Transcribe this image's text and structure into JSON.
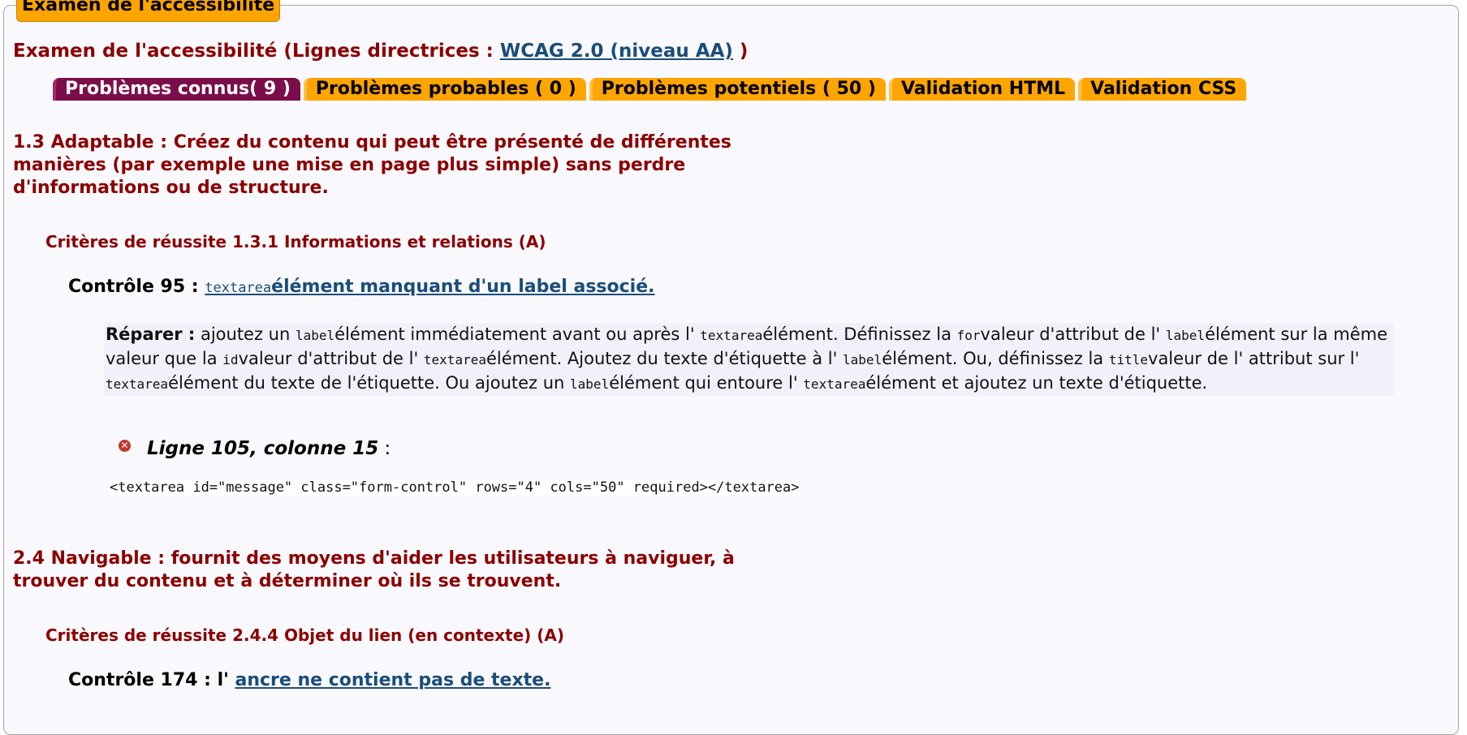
{
  "legend": "Examen de l'accessibilité",
  "main_title": {
    "prefix": "Examen de l'accessibilité (Lignes directrices : ",
    "link": "WCAG 2.0 (niveau AA)",
    "suffix": " )"
  },
  "tabs": [
    {
      "label": "Problèmes connus( 9 )",
      "active": true
    },
    {
      "label": "Problèmes probables ( 0 )",
      "active": false
    },
    {
      "label": "Problèmes potentiels ( 50 )",
      "active": false
    },
    {
      "label": "Validation HTML",
      "active": false
    },
    {
      "label": "Validation CSS",
      "active": false
    }
  ],
  "sections": [
    {
      "heading": "1.3 Adaptable : Créez du contenu qui peut être présenté de différentes manières (par exemple une mise en page plus simple) sans perdre d'informations ou de structure.",
      "criteria": "Critères de réussite 1.3.1 Informations et relations (A)",
      "control": {
        "prefix": "Contrôle 95 : ",
        "code": "textarea",
        "link": "élément manquant d'un label associé."
      },
      "repair": {
        "label": "Réparer :",
        "t1": " ajoutez un ",
        "c1": "label",
        "t2": "élément immédiatement avant ou après l' ",
        "c2": "textarea",
        "t3": "élément. Définissez la ",
        "c3": "for",
        "t4": "valeur d'attribut de l' ",
        "c4": "label",
        "t5": "élément sur la même valeur que la ",
        "c5": "id",
        "t6": "valeur d'attribut de l' ",
        "c6": "textarea",
        "t7": "élément. Ajoutez du texte d'étiquette à l' ",
        "c7": "label",
        "t8": "élément. Ou, définissez la ",
        "c8": "title",
        "t9": "valeur de l' attribut sur l' ",
        "c9": "textarea",
        "t10": "élément du texte de l'étiquette. Ou ajoutez un ",
        "c10": "label",
        "t11": "élément qui entoure l' ",
        "c11": "textarea",
        "t12": "élément et ajoutez un texte d'étiquette."
      },
      "line_ref": "Ligne 105, colonne 15",
      "line_ref_suffix": " :",
      "code_snippet": "<textarea id=\"message\" class=\"form-control\" rows=\"4\" cols=\"50\" required></textarea>"
    },
    {
      "heading": "2.4 Navigable : fournit des moyens d'aider les utilisateurs à naviguer, à trouver du contenu et à déterminer où ils se trouvent.",
      "criteria": "Critères de réussite 2.4.4 Objet du lien (en contexte) (A)",
      "control": {
        "prefix": "Contrôle 174 : l' ",
        "link": "ancre ne contient pas de texte."
      }
    }
  ],
  "colors": {
    "accent_orange": "#ffa500",
    "active_tab": "#7b0e4a",
    "heading_red": "#8b0000",
    "link_blue": "#1a4d7a"
  },
  "icons": {
    "error": "error-x-icon"
  }
}
